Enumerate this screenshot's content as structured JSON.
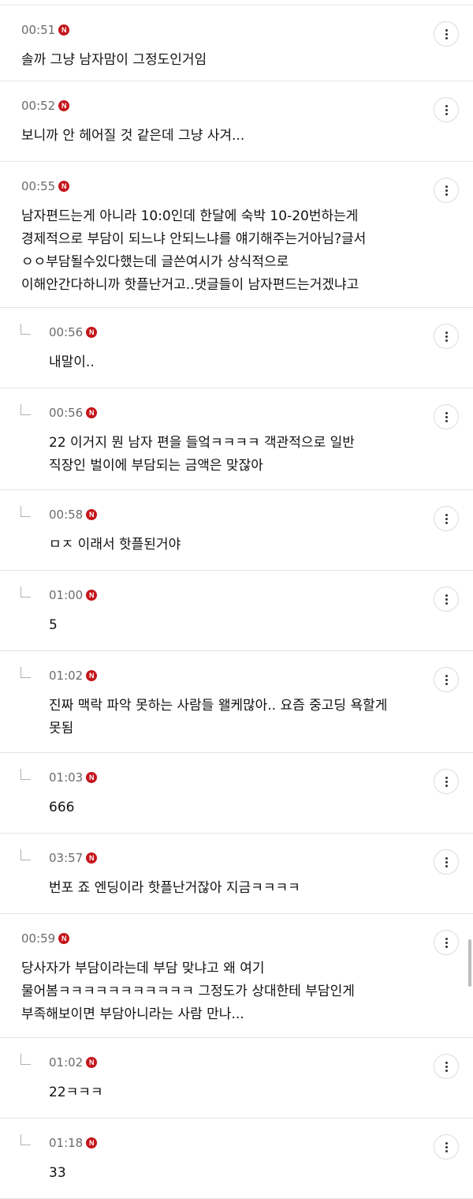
{
  "badge_letter": "N",
  "comments": [
    {
      "time": "00:51",
      "text": "솔까 그냥 남자맘이 그정도인거임",
      "reply": false
    },
    {
      "time": "00:52",
      "text": "보니까 안 헤어질 것 같은데 그냥 사겨...",
      "reply": false
    },
    {
      "time": "00:55",
      "text": "남자편드는게 아니라 10:0인데 한달에 숙박 10-20번하는게\n경제적으로 부담이 되느냐 안되느냐를 얘기해주는거아님?글서\nㅇㅇ부담될수있다했는데 글쓴여시가 상식적으로\n이해안간다하니까 핫플난거고..댓글들이 남자편드는거겠냐고",
      "reply": false
    },
    {
      "time": "00:56",
      "text": "내말이..",
      "reply": true
    },
    {
      "time": "00:56",
      "text": "22 이거지 뭔 남자 편을 들엌ㅋㅋㅋㅋ 객관적으로 일반\n직장인 벌이에 부담되는 금액은 맞잖아",
      "reply": true
    },
    {
      "time": "00:58",
      "text": "ㅁㅈ 이래서 핫플된거야",
      "reply": true
    },
    {
      "time": "01:00",
      "text": "5",
      "reply": true
    },
    {
      "time": "01:02",
      "text": "진짜 맥락 파악 못하는 사람들 왤케많아.. 요즘 중고딩 욕할게\n못됨",
      "reply": true
    },
    {
      "time": "01:03",
      "text": "666",
      "reply": true
    },
    {
      "time": "03:57",
      "text": "번포 죠 엔딩이라 핫플난거잖아 지금ㅋㅋㅋㅋ",
      "reply": true
    },
    {
      "time": "00:59",
      "text": "당사자가 부담이라는데 부담 맞냐고 왜 여기\n물어봄ㅋㅋㅋㅋㅋㅋㅋㅋㅋㅋㅋ 그정도가 상대한테 부담인게\n부족해보이면 부담아니라는 사람 만나...",
      "reply": false
    },
    {
      "time": "01:02",
      "text": "22ㅋㅋㅋ",
      "reply": true
    },
    {
      "time": "01:18",
      "text": "33",
      "reply": true
    }
  ]
}
